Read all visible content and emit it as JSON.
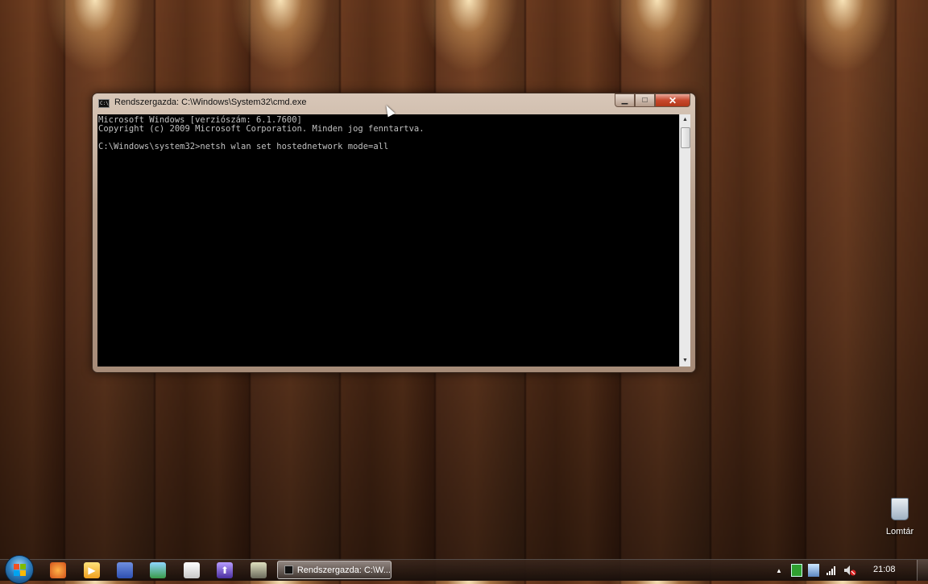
{
  "window": {
    "title": "Rendszergazda: C:\\Windows\\System32\\cmd.exe",
    "icon": "cmd-icon",
    "controls": {
      "minimize": "▁",
      "maximize": "□",
      "close": "✕"
    }
  },
  "console": {
    "lines": [
      "Microsoft Windows [verziószám: 6.1.7600]",
      "Copyright (c) 2009 Microsoft Corporation. Minden jog fenntartva.",
      "",
      "C:\\Windows\\system32>netsh wlan set hostednetwork mode=all"
    ]
  },
  "desktop": {
    "icons": [
      {
        "label": "Lomtár",
        "icon": "recycle-bin-icon"
      }
    ]
  },
  "taskbar": {
    "start": "windows-start-orb",
    "quick_launch": [
      "firefox-icon",
      "media-player-icon",
      "save-icon",
      "network-people-icon",
      "app-icon",
      "upload-icon",
      "tool-icon"
    ],
    "active_task": {
      "label": "Rendszergazda: C:\\W...",
      "icon": "cmd-icon"
    },
    "tray": {
      "up_arrow": "▲",
      "icons": [
        "green-app-icon",
        "network-icon",
        "signal-icon",
        "volume-muted-icon"
      ],
      "clock": "21:08"
    }
  },
  "colors": {
    "console_bg": "#000000",
    "console_text": "#c0c0c0",
    "close_button": "#c8482e"
  }
}
